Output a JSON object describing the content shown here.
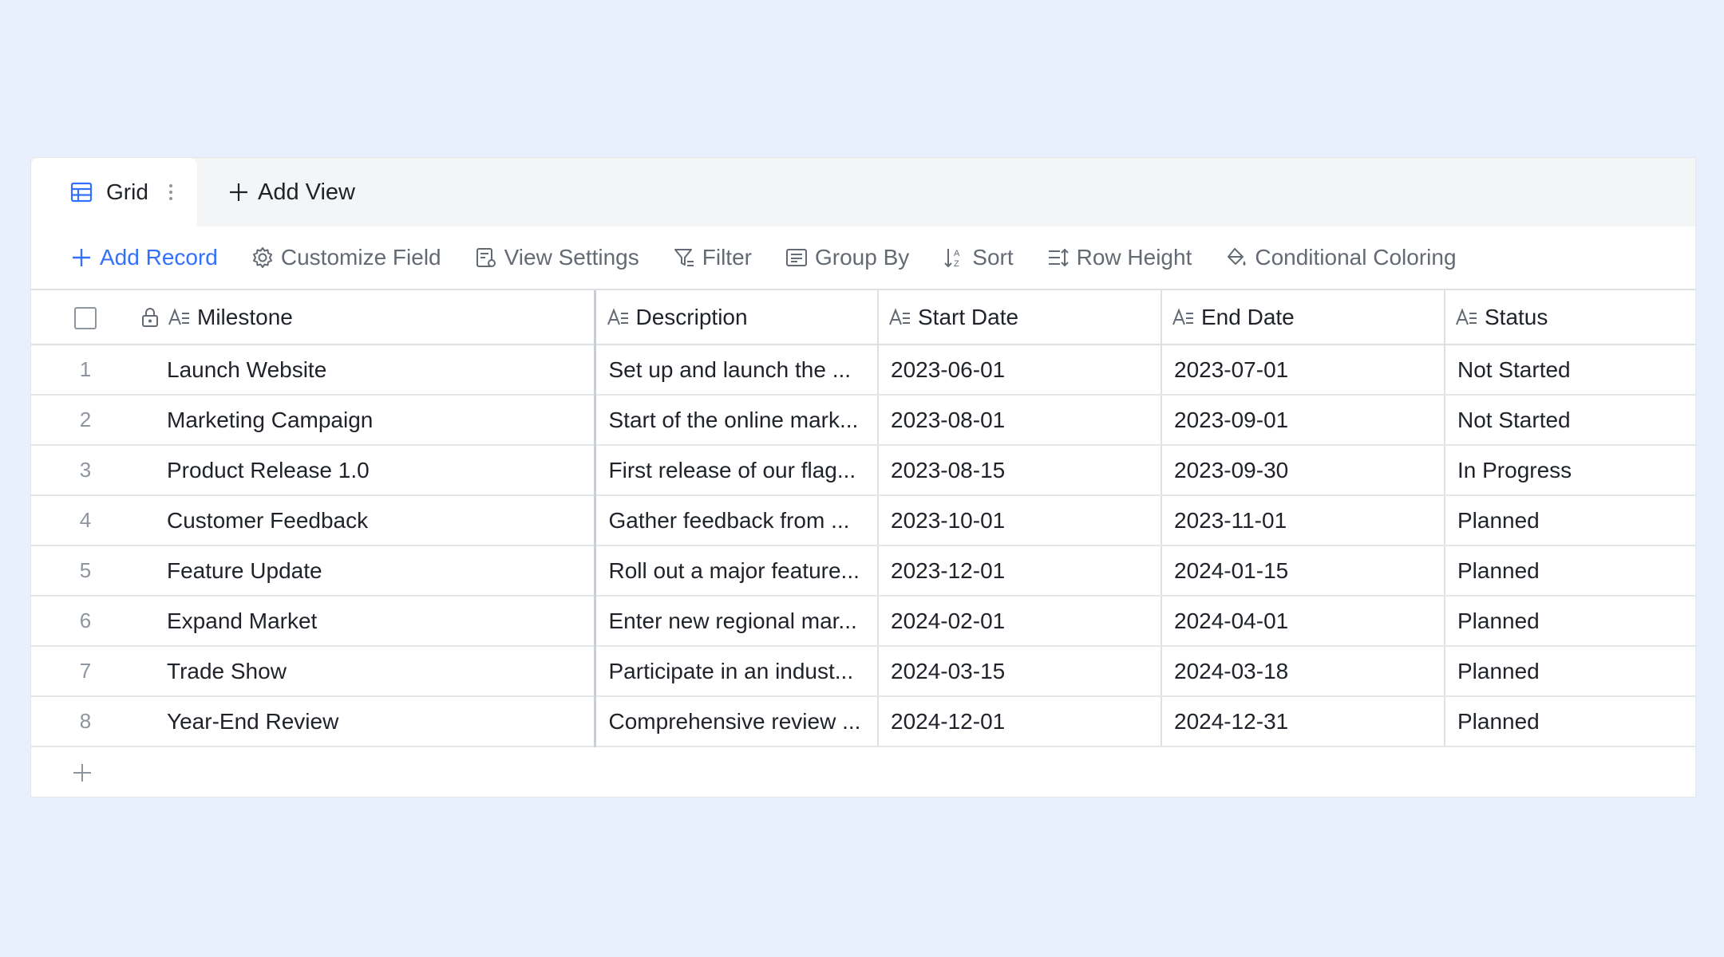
{
  "tabs": {
    "active": {
      "label": "Grid",
      "icon": "grid-table-icon"
    },
    "add_view_label": "Add View"
  },
  "toolbar": {
    "add_record": "Add Record",
    "customize_field": "Customize Field",
    "view_settings": "View Settings",
    "filter": "Filter",
    "group_by": "Group By",
    "sort": "Sort",
    "row_height": "Row Height",
    "conditional_coloring": "Conditional Coloring"
  },
  "colors": {
    "accent": "#3370ff",
    "page_background": "#e8effd",
    "muted_text": "#646a73"
  },
  "table": {
    "columns": {
      "milestone": "Milestone",
      "description": "Description",
      "start_date": "Start Date",
      "end_date": "End Date",
      "status": "Status"
    },
    "rows": [
      {
        "num": "1",
        "milestone": "Launch Website",
        "description": "Set up and launch the ...",
        "start": "2023-06-01",
        "end": "2023-07-01",
        "status": "Not Started"
      },
      {
        "num": "2",
        "milestone": "Marketing Campaign",
        "description": "Start of the online mark...",
        "start": "2023-08-01",
        "end": "2023-09-01",
        "status": "Not Started"
      },
      {
        "num": "3",
        "milestone": "Product Release 1.0",
        "description": "First release of our flag...",
        "start": "2023-08-15",
        "end": "2023-09-30",
        "status": "In Progress"
      },
      {
        "num": "4",
        "milestone": "Customer Feedback",
        "description": "Gather feedback from ...",
        "start": "2023-10-01",
        "end": "2023-11-01",
        "status": "Planned"
      },
      {
        "num": "5",
        "milestone": "Feature Update",
        "description": "Roll out a major feature...",
        "start": "2023-12-01",
        "end": "2024-01-15",
        "status": "Planned"
      },
      {
        "num": "6",
        "milestone": "Expand Market",
        "description": "Enter new regional mar...",
        "start": "2024-02-01",
        "end": "2024-04-01",
        "status": "Planned"
      },
      {
        "num": "7",
        "milestone": "Trade Show",
        "description": "Participate in an indust...",
        "start": "2024-03-15",
        "end": "2024-03-18",
        "status": "Planned"
      },
      {
        "num": "8",
        "milestone": "Year-End Review",
        "description": "Comprehensive review ...",
        "start": "2024-12-01",
        "end": "2024-12-31",
        "status": "Planned"
      }
    ]
  }
}
